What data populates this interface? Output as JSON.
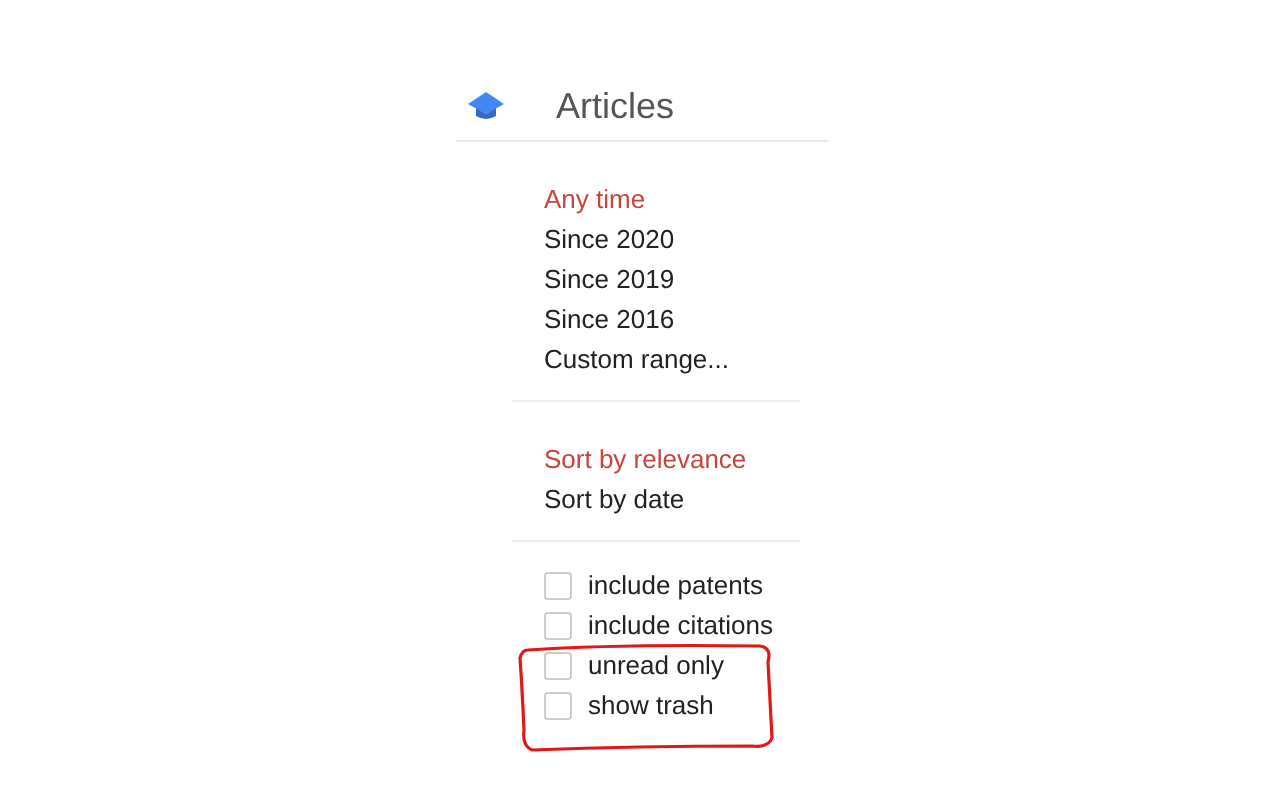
{
  "header": {
    "title": "Articles"
  },
  "time_filters": [
    {
      "label": "Any time",
      "selected": true
    },
    {
      "label": "Since 2020",
      "selected": false
    },
    {
      "label": "Since 2019",
      "selected": false
    },
    {
      "label": "Since 2016",
      "selected": false
    },
    {
      "label": "Custom range...",
      "selected": false
    }
  ],
  "sort_options": [
    {
      "label": "Sort by relevance",
      "selected": true
    },
    {
      "label": "Sort by date",
      "selected": false
    }
  ],
  "options": [
    {
      "label": "include patents",
      "checked": false,
      "highlighted": false
    },
    {
      "label": "include citations",
      "checked": false,
      "highlighted": false
    },
    {
      "label": "unread only",
      "checked": false,
      "highlighted": true
    },
    {
      "label": "show trash",
      "checked": false,
      "highlighted": true
    }
  ]
}
